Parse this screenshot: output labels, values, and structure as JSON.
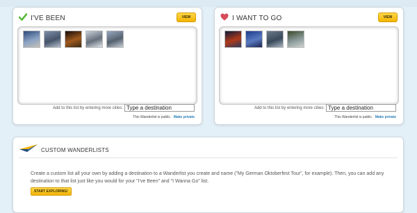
{
  "been": {
    "title": "I'VE BEEN",
    "view_label": "VIEW",
    "add_label": "Add to this list by entering more cities:",
    "input_value": "Type a destination",
    "privacy_text": "This Wanderlist is public.",
    "privacy_link": "Make private",
    "icon": "checkmark-icon",
    "thumbs": [
      {
        "name": "city-photo-1",
        "colors": [
          "#2e4a7a",
          "#8aa2c4",
          "#c4c0b5"
        ]
      },
      {
        "name": "city-photo-2",
        "colors": [
          "#7e8fa8",
          "#46546a",
          "#b6c0ce"
        ]
      },
      {
        "name": "city-photo-3",
        "colors": [
          "#140c08",
          "#a05a1e",
          "#3c2a14"
        ]
      },
      {
        "name": "city-photo-4",
        "colors": [
          "#c8cfd8",
          "#65707c",
          "#e0e4ea"
        ]
      },
      {
        "name": "city-photo-5",
        "colors": [
          "#97a8c0",
          "#54606d",
          "#c6ced8"
        ]
      }
    ]
  },
  "want": {
    "title": "I WANT TO GO",
    "view_label": "VIEW",
    "add_label": "Add to this list by entering more cities:",
    "input_value": "Type a destination",
    "privacy_text": "This Wanderlist is public.",
    "privacy_link": "Make private",
    "icon": "heart-icon",
    "thumbs": [
      {
        "name": "city-photo-1",
        "colors": [
          "#0d1a3a",
          "#b03a1a",
          "#2c3a5a"
        ]
      },
      {
        "name": "city-photo-2",
        "colors": [
          "#1e3c8c",
          "#5a7ac0",
          "#1a2450"
        ]
      },
      {
        "name": "city-photo-3",
        "colors": [
          "#6a7a8a",
          "#3a4a5a",
          "#a9b6c2"
        ]
      },
      {
        "name": "city-photo-4",
        "colors": [
          "#3a4a2a",
          "#8a9a9a",
          "#cfd4d0"
        ]
      }
    ]
  },
  "custom": {
    "title": "CUSTOM WANDERLISTS",
    "description": "Create a custom list all your own by adding a destination to a Wanderlist you create and name (\"My German Oktoberfest Tour\", for example). Then, you can add any destination to that list just like you would for your \"I've Been\" and \"I Wanna Go\" list.",
    "button_label": "START EXPLORING!",
    "icon": "paper-plane-icon"
  },
  "colors": {
    "accent_yellow": "#f2b300",
    "link_blue": "#2a7fb8",
    "check_green": "#5cb83a",
    "heart_red": "#d64a5a"
  }
}
